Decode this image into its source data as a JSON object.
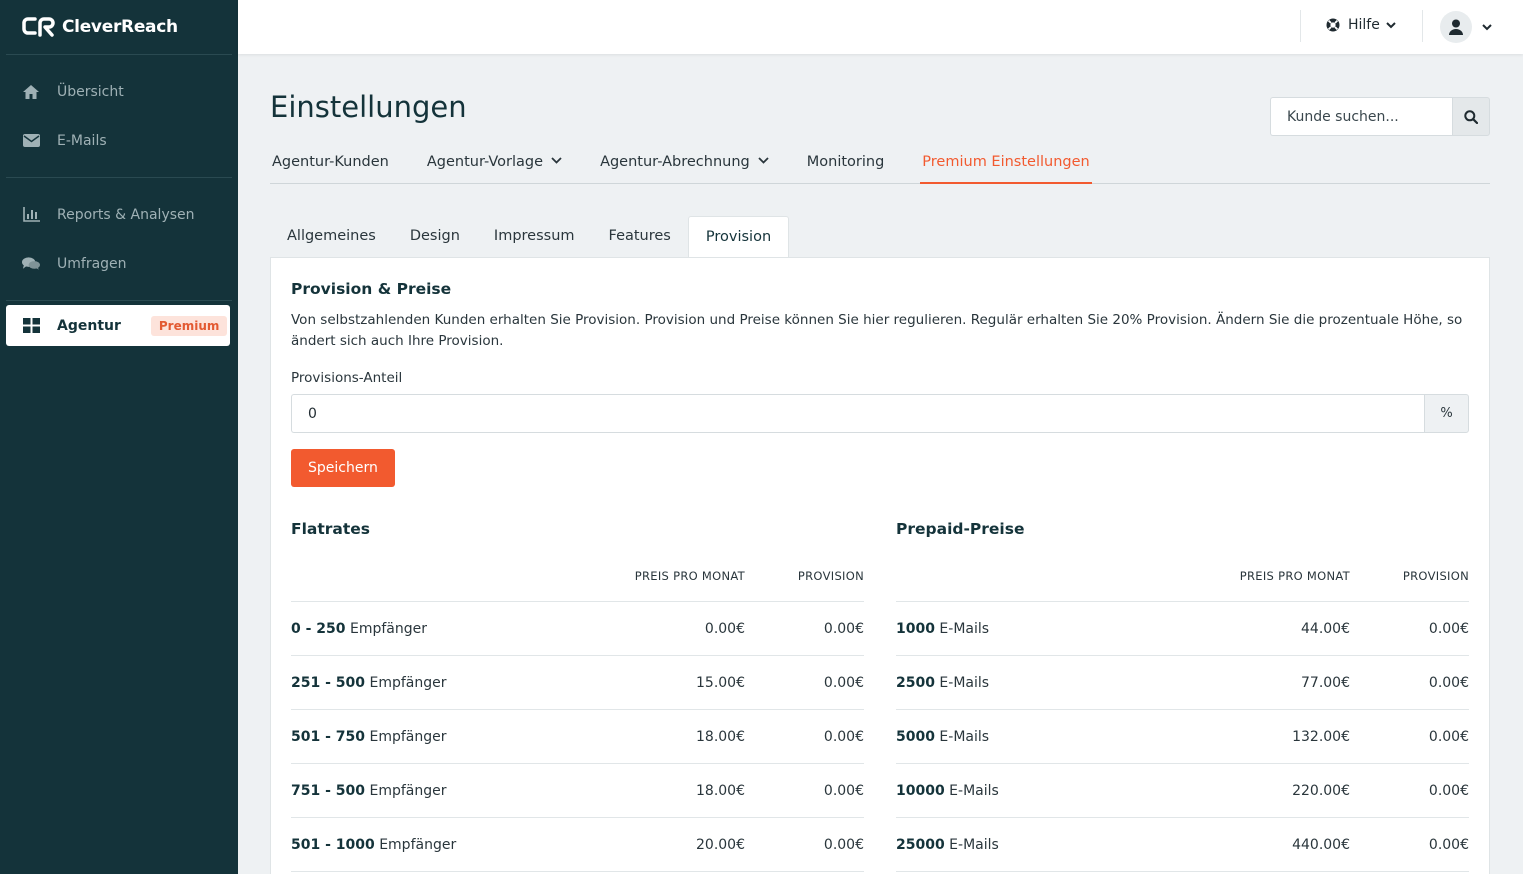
{
  "brand": {
    "name": "CleverReach"
  },
  "sidebar": {
    "items": [
      {
        "label": "Übersicht",
        "icon": "home-icon"
      },
      {
        "label": "E-Mails",
        "icon": "envelope-icon"
      },
      {
        "label": "Reports & Analysen",
        "icon": "bar-chart-icon"
      },
      {
        "label": "Umfragen",
        "icon": "comments-icon"
      }
    ],
    "active": {
      "label": "Agentur",
      "badge": "Premium",
      "icon": "grid-icon"
    }
  },
  "topbar": {
    "help_label": "Hilfe"
  },
  "page": {
    "title": "Einstellungen"
  },
  "search": {
    "placeholder": "Kunde suchen..."
  },
  "main_tabs": [
    {
      "label": "Agentur-Kunden"
    },
    {
      "label": "Agentur-Vorlage"
    },
    {
      "label": "Agentur-Abrechnung"
    },
    {
      "label": "Monitoring"
    },
    {
      "label": "Premium Einstellungen"
    }
  ],
  "sub_tabs": [
    {
      "label": "Allgemeines"
    },
    {
      "label": "Design"
    },
    {
      "label": "Impressum"
    },
    {
      "label": "Features"
    },
    {
      "label": "Provision"
    }
  ],
  "provision": {
    "title": "Provision & Preise",
    "description": "Von selbstzahlenden Kunden erhalten Sie Provision. Provision und Preise können Sie hier regulieren. Regulär erhalten Sie 20% Provision. Ändern Sie die prozentuale Höhe, so ändert sich auch Ihre Provision.",
    "field_label": "Provisions-Anteil",
    "field_value": "0",
    "unit": "%",
    "save_label": "Speichern"
  },
  "flatrates": {
    "title": "Flatrates",
    "headers": [
      "PREIS PRO MONAT",
      "PROVISION"
    ],
    "rows": [
      {
        "range": "0 - 250",
        "unit": "Empfänger",
        "price": "0.00€",
        "provision": "0.00€"
      },
      {
        "range": "251 - 500",
        "unit": "Empfänger",
        "price": "15.00€",
        "provision": "0.00€"
      },
      {
        "range": "501 - 750",
        "unit": "Empfänger",
        "price": "18.00€",
        "provision": "0.00€"
      },
      {
        "range": "751 - 500",
        "unit": "Empfänger",
        "price": "18.00€",
        "provision": "0.00€"
      },
      {
        "range": "501 - 1000",
        "unit": "Empfänger",
        "price": "20.00€",
        "provision": "0.00€"
      }
    ]
  },
  "prepaid": {
    "title": "Prepaid-Preise",
    "headers": [
      "PREIS PRO MONAT",
      "PROVISION"
    ],
    "rows": [
      {
        "range": "1000",
        "unit": "E-Mails",
        "price": "44.00€",
        "provision": "0.00€"
      },
      {
        "range": "2500",
        "unit": "E-Mails",
        "price": "77.00€",
        "provision": "0.00€"
      },
      {
        "range": "5000",
        "unit": "E-Mails",
        "price": "132.00€",
        "provision": "0.00€"
      },
      {
        "range": "10000",
        "unit": "E-Mails",
        "price": "220.00€",
        "provision": "0.00€"
      },
      {
        "range": "25000",
        "unit": "E-Mails",
        "price": "440.00€",
        "provision": "0.00€"
      }
    ]
  },
  "colors": {
    "sidebar_bg": "#14333a",
    "accent": "#f25a2f",
    "page_bg": "#eef1f3"
  }
}
